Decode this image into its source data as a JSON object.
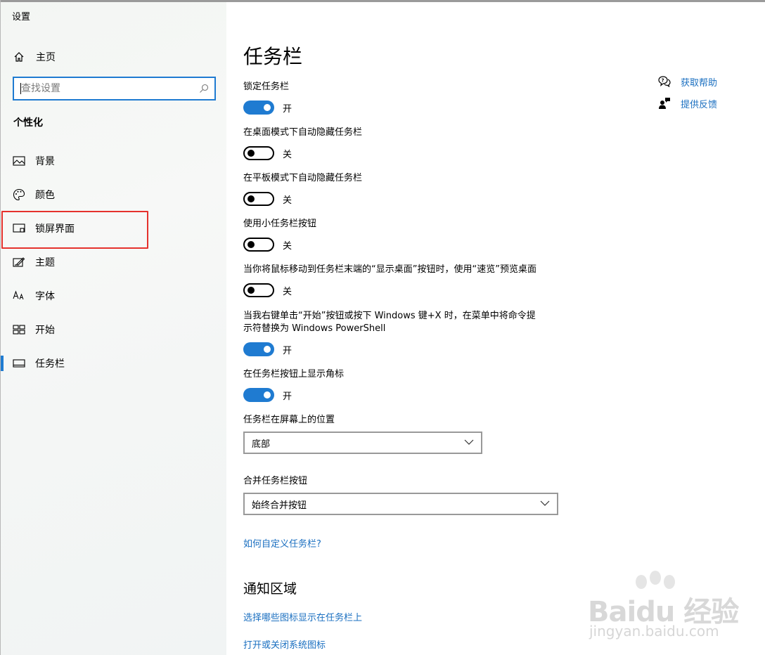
{
  "app_title": "设置",
  "sidebar": {
    "home_label": "主页",
    "search_placeholder": "查找设置",
    "section_header": "个性化",
    "items": [
      {
        "label": "背景",
        "icon": "image-icon"
      },
      {
        "label": "颜色",
        "icon": "palette-icon"
      },
      {
        "label": "锁屏界面",
        "icon": "lock-screen-icon"
      },
      {
        "label": "主题",
        "icon": "theme-icon"
      },
      {
        "label": "字体",
        "icon": "font-icon"
      },
      {
        "label": "开始",
        "icon": "start-icon"
      },
      {
        "label": "任务栏",
        "icon": "taskbar-icon",
        "active": true
      }
    ]
  },
  "main": {
    "title": "任务栏",
    "settings": [
      {
        "label": "锁定任务栏",
        "state": "开",
        "on": true
      },
      {
        "label": "在桌面模式下自动隐藏任务栏",
        "state": "关",
        "on": false
      },
      {
        "label": "在平板模式下自动隐藏任务栏",
        "state": "关",
        "on": false
      },
      {
        "label": "使用小任务栏按钮",
        "state": "关",
        "on": false
      },
      {
        "label": "当你将鼠标移动到任务栏末端的“显示桌面”按钮时，使用“速览”预览桌面",
        "state": "关",
        "on": false
      },
      {
        "label_line1": "当我右键单击“开始”按钮或按下 Windows 键+X 时，在菜单中将命令提",
        "label_line2": "示符替换为 Windows PowerShell",
        "state": "开",
        "on": true
      },
      {
        "label": "在任务栏按钮上显示角标",
        "state": "开",
        "on": true
      }
    ],
    "position": {
      "label": "任务栏在屏幕上的位置",
      "value": "底部"
    },
    "combine": {
      "label": "合并任务栏按钮",
      "value": "始终合并按钮"
    },
    "customize_link": "如何自定义任务栏?",
    "notification_title": "通知区域",
    "notification_links": [
      "选择哪些图标显示在任务栏上",
      "打开或关闭系统图标"
    ]
  },
  "help": {
    "get_help": "获取帮助",
    "feedback": "提供反馈"
  },
  "watermark": {
    "brand": "Baidu 经验",
    "url": "jingyan.baidu.com"
  },
  "colors": {
    "accent": "#1f7bd1",
    "link": "#1a6fc0",
    "highlight_border": "#e5322d"
  }
}
